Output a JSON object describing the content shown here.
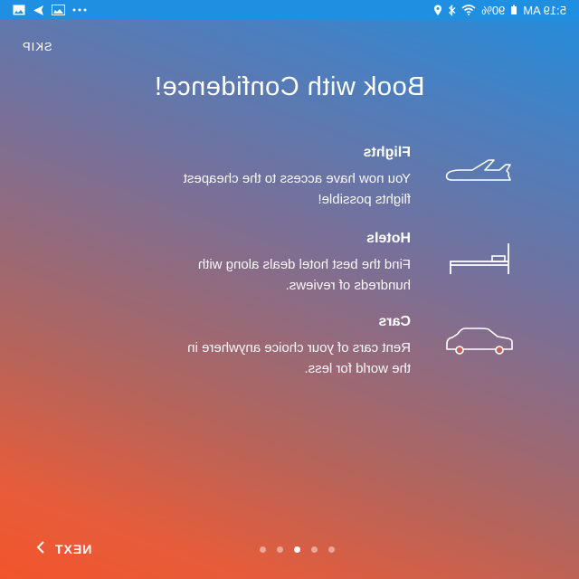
{
  "status_bar": {
    "time": "5:19 AM",
    "battery": "90%",
    "icons": [
      "battery-icon",
      "wifi-icon",
      "bluetooth-icon",
      "location-icon",
      "more-dots-icon",
      "gallery-icon",
      "messenger-icon",
      "image-icon"
    ]
  },
  "header": {
    "skip_label": "SKIP",
    "title": "Book with Confidence!"
  },
  "features": [
    {
      "icon": "plane-icon",
      "title": "Flights",
      "description": "You now have access to the cheapest flights possible!"
    },
    {
      "icon": "bed-icon",
      "title": "Hotels",
      "description": "Find the best hotel deals along with hundreds of reviews."
    },
    {
      "icon": "car-icon",
      "title": "Cars",
      "description": "Rent cars of your choice anywhere in the world for less."
    }
  ],
  "pager": {
    "count": 5,
    "active_index": 2
  },
  "footer": {
    "next_label": "NEXT"
  },
  "colors": {
    "status_bar": "#1e8fe1",
    "gradient_top": "#1f8ede",
    "gradient_bottom": "#f2552c"
  }
}
